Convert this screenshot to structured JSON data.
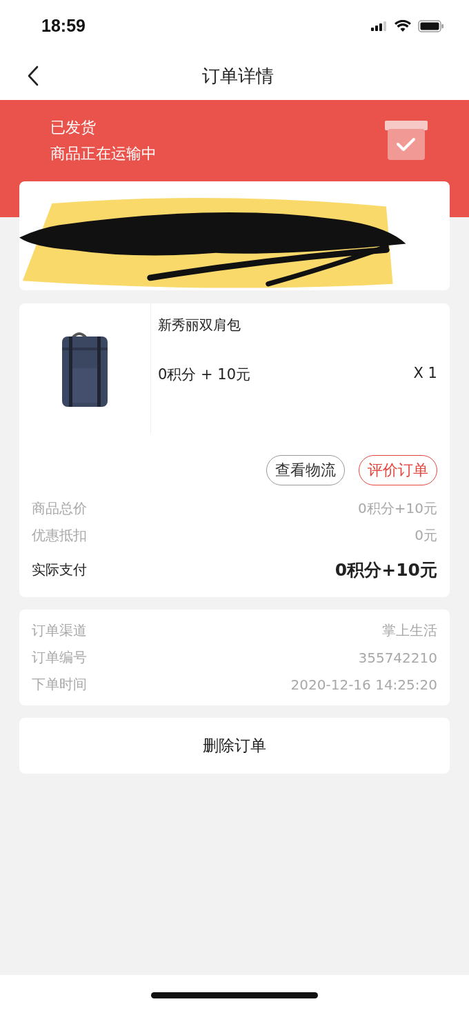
{
  "status_bar": {
    "time": "18:59"
  },
  "nav": {
    "title": "订单详情"
  },
  "banner": {
    "status": "已发货",
    "subtitle": "商品正在运输中"
  },
  "address_card": {
    "kind": "redacted"
  },
  "product": {
    "name": "新秀丽双肩包",
    "price": "0积分 + 10元",
    "quantity": "X 1",
    "buttons": [
      {
        "label": "查看物流",
        "kind": "outline"
      },
      {
        "label": "评价订单",
        "kind": "accent"
      }
    ]
  },
  "summary": [
    {
      "label": "商品总价",
      "value": "0积分+10元",
      "kind": "muted"
    },
    {
      "label": "优惠抵扣",
      "value": "0元",
      "kind": "muted"
    },
    {
      "label": "实际支付",
      "value": "0积分+10元",
      "kind": "total"
    }
  ],
  "info": [
    {
      "label": "订单渠道",
      "value": "掌上生活"
    },
    {
      "label": "订单编号",
      "value": "355742210"
    },
    {
      "label": "下单时间",
      "value": "2020-12-16 14:25:20"
    }
  ],
  "delete_button": {
    "label": "删除订单"
  }
}
